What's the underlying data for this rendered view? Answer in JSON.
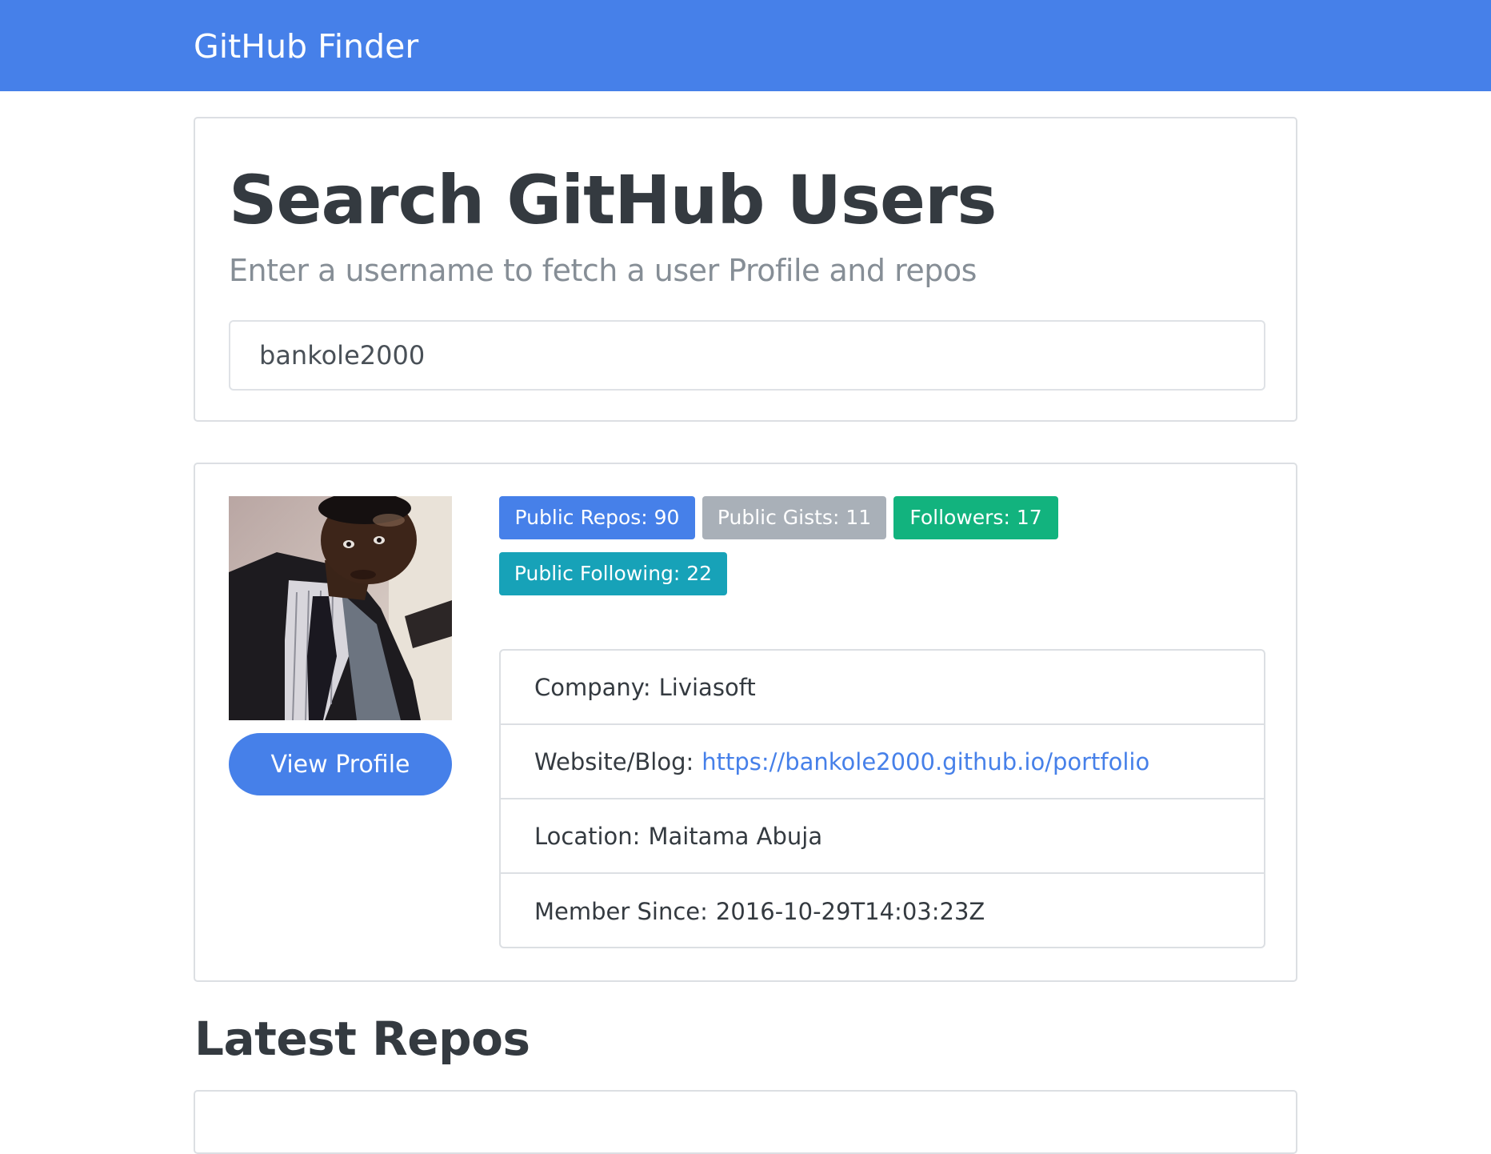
{
  "navbar": {
    "brand": "GitHub Finder"
  },
  "search": {
    "title": "Search GitHub Users",
    "subtitle": "Enter a username to fetch a user Profile and repos",
    "value": "bankole2000"
  },
  "profile": {
    "view_profile_label": "View Profile",
    "badges": {
      "public_repos": "Public Repos: 90",
      "public_gists": "Public Gists: 11",
      "followers": "Followers: 17",
      "following": "Public Following: 22"
    },
    "details": {
      "company_label": "Company:",
      "company": "Liviasoft",
      "website_label": "Website/Blog:",
      "website": "https://bankole2000.github.io/portfolio",
      "location_label": "Location:",
      "location": "Maitama Abuja",
      "member_since_label": "Member Since:",
      "member_since": "2016-10-29T14:03:23Z"
    }
  },
  "repos": {
    "title": "Latest Repos"
  },
  "colors": {
    "primary": "#4680e9",
    "secondary": "#a9b0b8",
    "success": "#12b37e",
    "info": "#17a2b8"
  }
}
